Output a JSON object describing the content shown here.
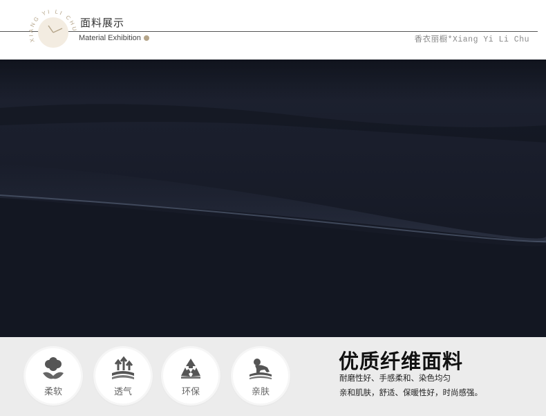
{
  "header": {
    "logo_text": "XIANG YI LI CHU",
    "title_cn": "面料展示",
    "title_en": "Material Exhibition",
    "brand": "香衣丽橱*Xiang Yi Li Chu"
  },
  "features": {
    "items": [
      {
        "label": "柔软",
        "icon": "cotton-flower-icon"
      },
      {
        "label": "透气",
        "icon": "breathable-arrows-icon"
      },
      {
        "label": "环保",
        "icon": "recycle-icon"
      },
      {
        "label": "亲肤",
        "icon": "baby-crawling-icon"
      }
    ],
    "title": "优质纤维面料",
    "line1": "耐磨性好、手感柔和、染色均匀",
    "line2": "亲和肌肤，舒适、保暖性好，时尚感强。"
  },
  "colors": {
    "fabric": "#1a1e2c",
    "band": "#ececec",
    "accent_gold": "#b5a58a"
  }
}
